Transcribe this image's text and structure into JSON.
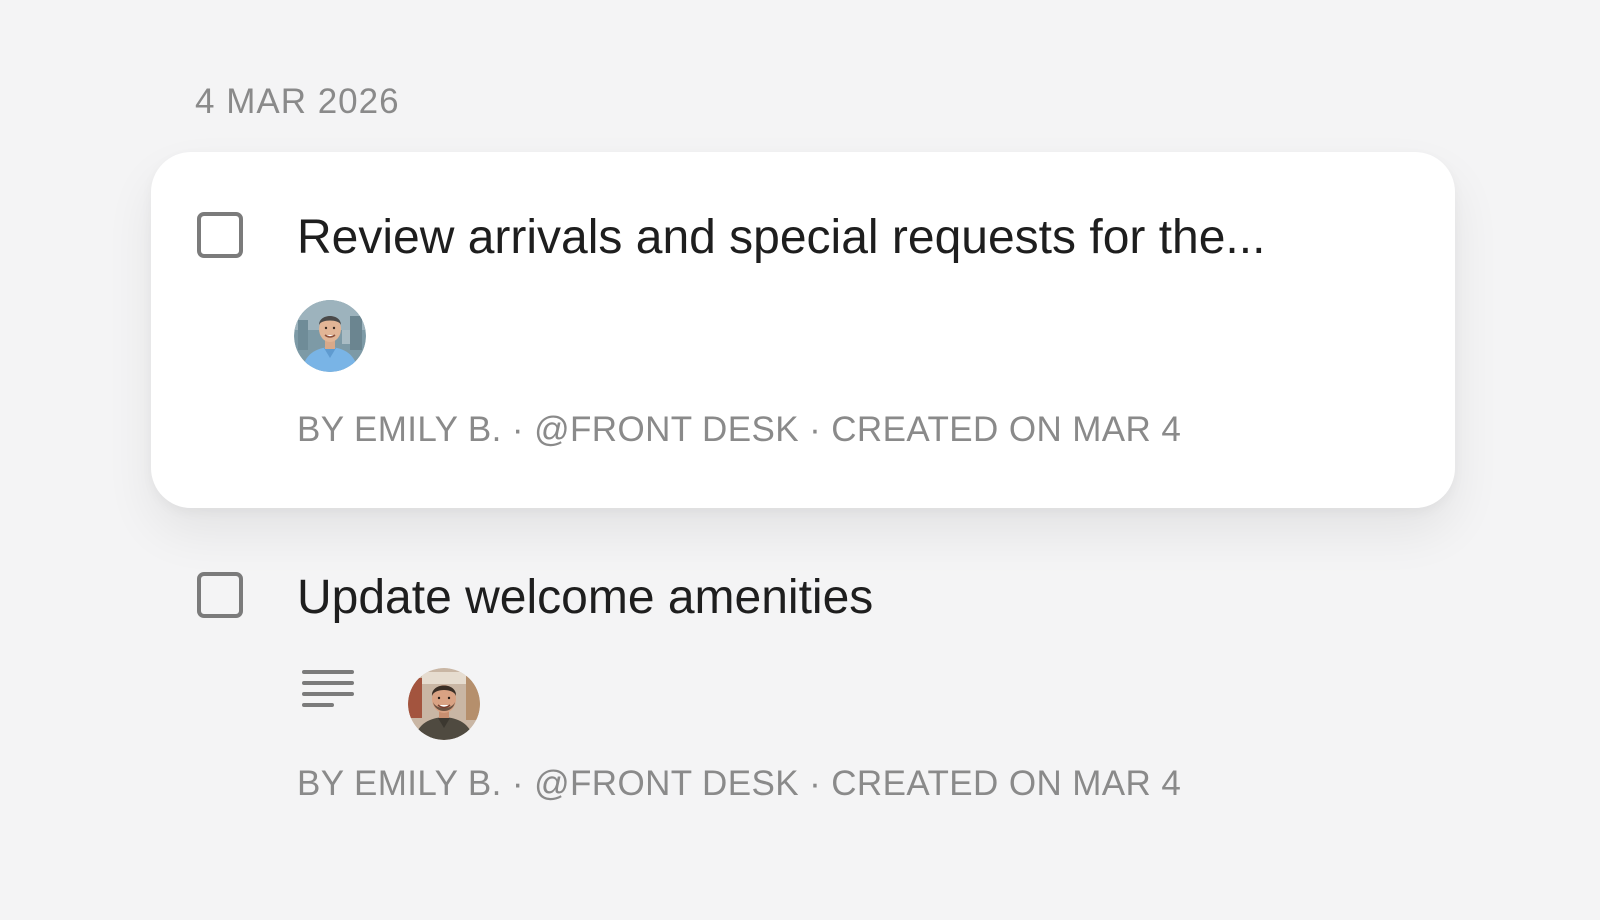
{
  "date_header": "4 MAR 2026",
  "tasks": [
    {
      "title": "Review  arrivals and special requests for the...",
      "meta": "BY EMILY B. · @FRONT DESK · CREATED ON MAR 4",
      "completed": false,
      "has_notes": false,
      "assignee_avatar": "man-light-blue-shirt-avatar"
    },
    {
      "title": "Update welcome amenities",
      "meta": "BY EMILY B. · @FRONT DESK · CREATED ON MAR 4",
      "completed": false,
      "has_notes": true,
      "notes_icon": "notes-lines-icon",
      "assignee_avatar": "man-smiling-avatar"
    }
  ],
  "colors": {
    "background": "#f4f4f5",
    "card": "#ffffff",
    "text_primary": "#1e1e1e",
    "text_secondary": "#8a8a8a",
    "checkbox_border": "#7b7b7b"
  }
}
